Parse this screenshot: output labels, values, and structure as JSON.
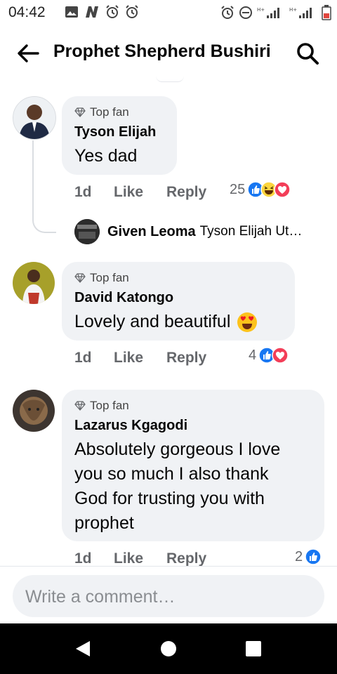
{
  "status": {
    "time": "04:42"
  },
  "header": {
    "title": "Prophet Shepherd Bushiri"
  },
  "comments": [
    {
      "badge": "Top fan",
      "author": "Tyson Elijah",
      "text": "Yes dad",
      "time": "1d",
      "like": "Like",
      "reply": "Reply",
      "reactions_count": "25"
    },
    {
      "badge": "Top fan",
      "author": "David Katongo",
      "text": "Lovely and beautiful",
      "time": "1d",
      "like": "Like",
      "reply": "Reply",
      "reactions_count": "4"
    },
    {
      "badge": "Top fan",
      "author": "Lazarus Kgagodi",
      "lines": [
        "Absolutely gorgeous I love",
        "you so much I also thank",
        "God for trusting you with",
        "prophet"
      ],
      "time": "1d",
      "like": "Like",
      "reply": "Reply",
      "reactions_count": "2"
    }
  ],
  "reply_preview": {
    "author": "Given Leoma",
    "text": "Tyson Elijah  Ut…"
  },
  "composer": {
    "placeholder": "Write a comment…"
  },
  "colors": {
    "like_blue": "#1877f2",
    "love_red": "#f33e58",
    "haha_yellow": "#fcd53f",
    "bubble_bg": "#f0f2f5",
    "meta_gray": "#65676b"
  },
  "icons": [
    "back-arrow-icon",
    "search-icon",
    "diamond-icon",
    "like-reaction-icon",
    "haha-reaction-icon",
    "love-reaction-icon",
    "heart-eyes-emoji-icon",
    "nav-back-icon",
    "nav-home-icon",
    "nav-recents-icon"
  ]
}
